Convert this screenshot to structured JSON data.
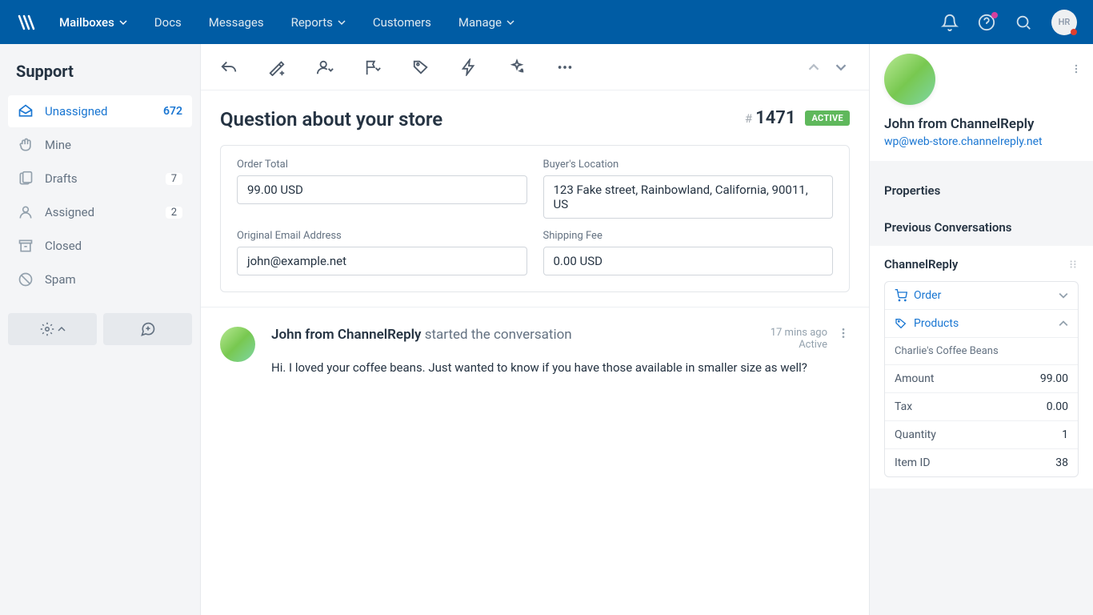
{
  "nav": {
    "items": [
      "Mailboxes",
      "Docs",
      "Messages",
      "Reports",
      "Customers",
      "Manage"
    ],
    "avatar": "HR"
  },
  "sidebar": {
    "title": "Support",
    "items": [
      {
        "label": "Unassigned",
        "count": "672"
      },
      {
        "label": "Mine"
      },
      {
        "label": "Drafts",
        "count": "7"
      },
      {
        "label": "Assigned",
        "count": "2"
      },
      {
        "label": "Closed"
      },
      {
        "label": "Spam"
      }
    ]
  },
  "conversation": {
    "title": "Question about your store",
    "id": "1471",
    "status": "ACTIVE",
    "fields": {
      "order_total": {
        "label": "Order Total",
        "value": "99.00 USD"
      },
      "buyer_location": {
        "label": "Buyer's Location",
        "value": "123 Fake street, Rainbowland, California, 90011, US"
      },
      "original_email": {
        "label": "Original Email Address",
        "value": "john@example.net"
      },
      "shipping_fee": {
        "label": "Shipping Fee",
        "value": "0.00 USD"
      }
    },
    "thread": {
      "who": "John from ChannelReply",
      "action": " started the conversation",
      "time": "17 mins ago",
      "state": "Active",
      "text": "Hi. I loved your coffee beans. Just wanted to know if you have those available in smaller size as well?"
    }
  },
  "profile": {
    "name": "John from ChannelReply",
    "email": "wp@web-store.channelreply.net"
  },
  "panel": {
    "properties": "Properties",
    "prev": "Previous Conversations",
    "app": "ChannelReply",
    "order": "Order",
    "products": "Products",
    "product_name": "Charlie's Coffee Beans",
    "rows": [
      {
        "k": "Amount",
        "v": "99.00"
      },
      {
        "k": "Tax",
        "v": "0.00"
      },
      {
        "k": "Quantity",
        "v": "1"
      },
      {
        "k": "Item ID",
        "v": "38"
      }
    ]
  }
}
